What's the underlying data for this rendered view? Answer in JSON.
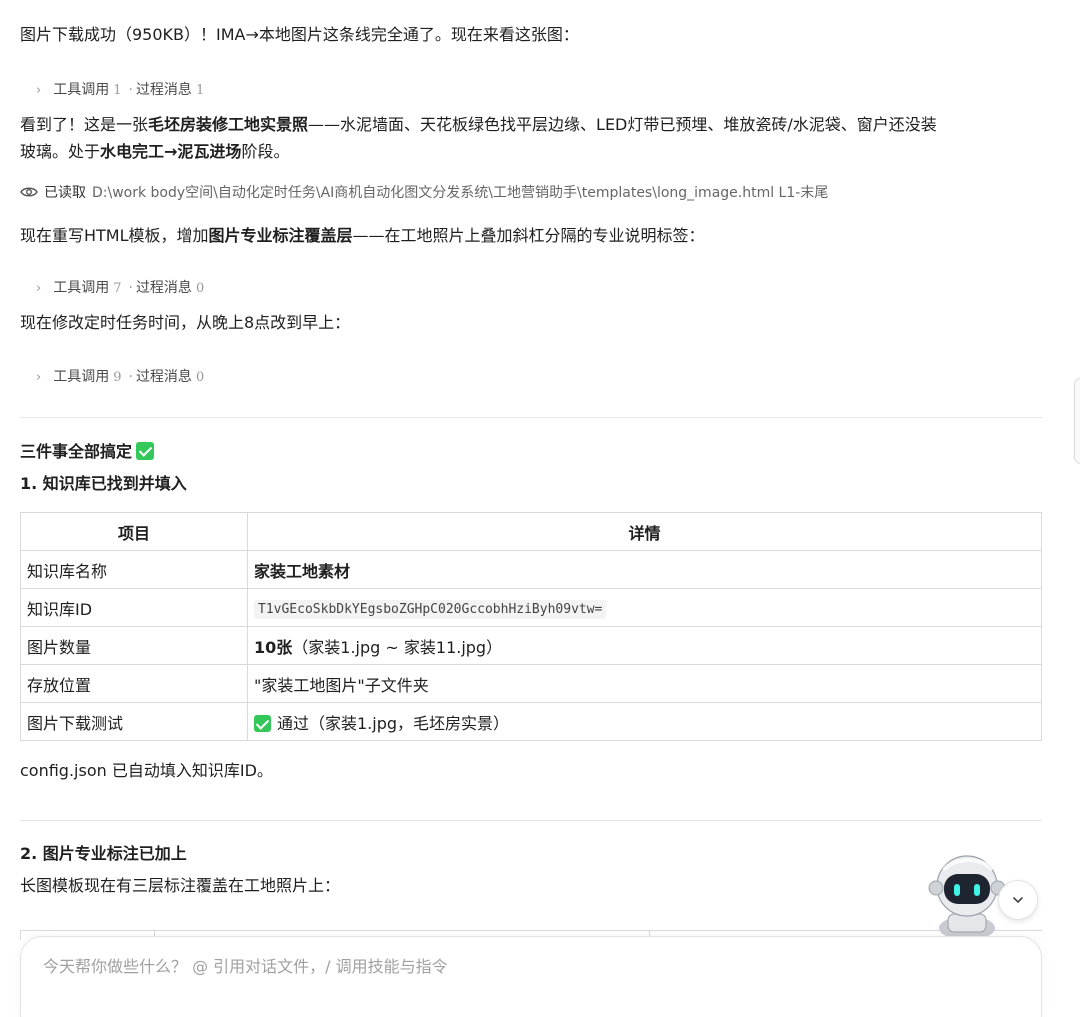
{
  "messages": {
    "p1": "图片下载成功（950KB）！IMA→本地图片这条线完全通了。现在来看这张图：",
    "tool1": {
      "label1": "工具调用",
      "n1": "1",
      "label2": "过程消息",
      "n2": "1"
    },
    "p2": {
      "a": "看到了！这是一张",
      "b": "毛坯房装修工地实景照",
      "c": "——水泥墙面、天花板绿色找平层边缘、LED灯带已预埋、堆放瓷砖/水泥袋、窗户还没装"
    },
    "p2b": {
      "a": "玻璃。处于",
      "b": "水电完工→泥瓦进场",
      "c": "阶段。"
    },
    "read": {
      "label": "已读取",
      "path": "D:\\work body空间\\自动化定时任务\\AI商机自动化图文分发系统\\工地营销助手\\templates\\long_image.html  L1-末尾"
    },
    "p3": {
      "a": "现在重写HTML模板，增加",
      "b": "图片专业标注覆盖层",
      "c": "——在工地照片上叠加斜杠分隔的专业说明标签："
    },
    "tool2": {
      "label1": "工具调用",
      "n1": "7",
      "label2": "过程消息",
      "n2": "0"
    },
    "p4": "现在修改定时任务时间，从晚上8点改到早上：",
    "tool3": {
      "label1": "工具调用",
      "n1": "9",
      "label2": "过程消息",
      "n2": "0"
    },
    "h_done": "三件事全部搞定",
    "h1": "1. 知识库已找到并填入",
    "table": {
      "headers": [
        "项目",
        "详情"
      ],
      "rows": [
        {
          "k": "知识库名称",
          "v": "家装工地素材"
        },
        {
          "k": "知识库ID",
          "v": "T1vGEcoSkbDkYEgsboZGHpC020GccobhHziByh09vtw="
        },
        {
          "k": "图片数量",
          "v_bold": "10张",
          "v": "（家装1.jpg ~ 家装11.jpg）"
        },
        {
          "k": "存放位置",
          "v": "\"家装工地图片\"子文件夹"
        },
        {
          "k": "图片下载测试",
          "v": "通过（家装1.jpg，毛坯房实景）"
        }
      ]
    },
    "p5": "config.json 已自动填入知识库ID。",
    "h2": "2. 图片专业标注已加上",
    "p6": "长图模板现在有三层标注覆盖在工地照片上："
  },
  "input": {
    "placeholder": "今天帮你做些什么？ @ 引用对话文件，/ 调用技能与指令"
  },
  "colors": {
    "check": "#34c759",
    "border": "#d9d9d9",
    "text": "#1f1f1f"
  },
  "icons": [
    "eye-icon",
    "check-icon",
    "chevron-right-icon",
    "chevron-down-icon",
    "robot-avatar"
  ]
}
